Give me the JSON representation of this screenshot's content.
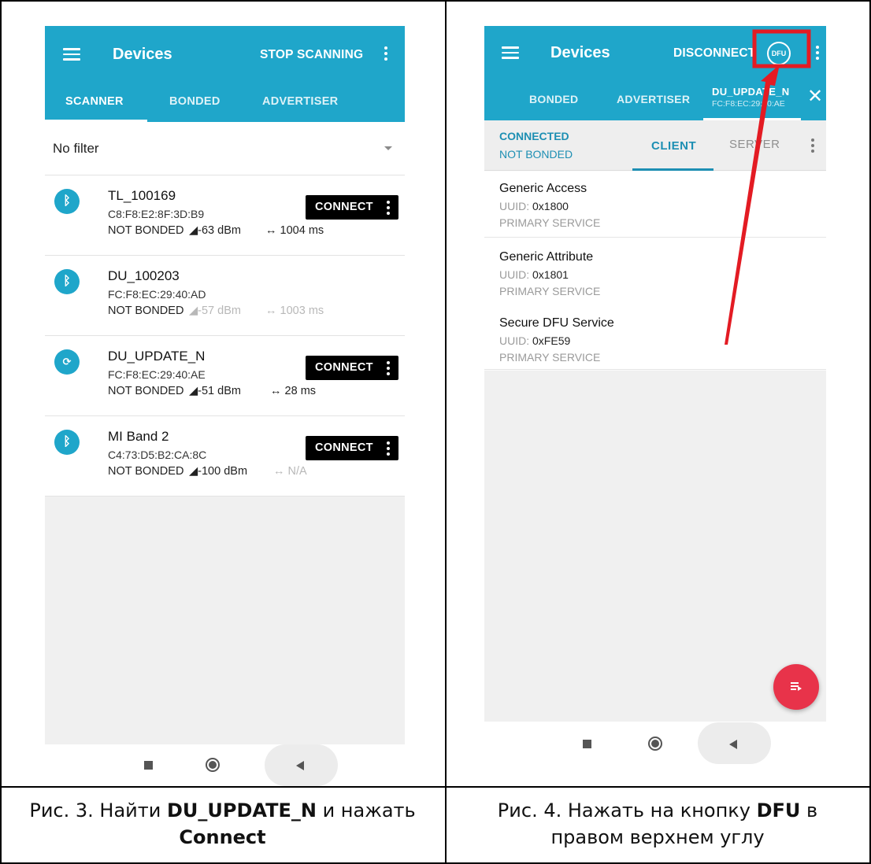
{
  "left_screen": {
    "app_bar": {
      "title": "Devices",
      "action": "STOP SCANNING"
    },
    "tabs": [
      {
        "label": "SCANNER",
        "active": true
      },
      {
        "label": "BONDED",
        "active": false
      },
      {
        "label": "ADVERTISER",
        "active": false
      }
    ],
    "filter": {
      "value": "No filter"
    },
    "devices": [
      {
        "name": "TL_100169",
        "mac": "C8:F8:E2:8F:3D:B9",
        "bond": "NOT BONDED",
        "rssi": "-63 dBm",
        "interval": "1004 ms",
        "connect_label": "CONNECT",
        "connectable": true,
        "icon": "bluetooth-icon"
      },
      {
        "name": "DU_100203",
        "mac": "FC:F8:EC:29:40:AD",
        "bond": "NOT BONDED",
        "rssi": "-57 dBm",
        "interval": "1003 ms",
        "connect_label": "",
        "connectable": false,
        "icon": "bluetooth-icon"
      },
      {
        "name": "DU_UPDATE_N",
        "mac": "FC:F8:EC:29:40:AE",
        "bond": "NOT BONDED",
        "rssi": "-51 dBm",
        "interval": "28 ms",
        "connect_label": "CONNECT",
        "connectable": true,
        "icon": "dfu-device-icon"
      },
      {
        "name": "MI Band 2",
        "mac": "C4:73:D5:B2:CA:8C",
        "bond": "NOT BONDED",
        "rssi": "-100 dBm",
        "interval": "N/A",
        "connect_label": "CONNECT",
        "connectable": true,
        "icon": "bluetooth-icon"
      }
    ]
  },
  "right_screen": {
    "app_bar": {
      "title": "Devices",
      "action": "DISCONNECT",
      "dfu_icon_text": "DFU"
    },
    "tabs": [
      {
        "label": "BONDED"
      },
      {
        "label": "ADVERTISER"
      },
      {
        "label": "DU_UPDATE_N",
        "sublabel": "FC:F8:EC:29:40:AE",
        "active": true
      }
    ],
    "connection": {
      "state": "CONNECTED",
      "bond": "NOT BONDED"
    },
    "sub_tabs": [
      {
        "label": "CLIENT",
        "active": true
      },
      {
        "label": "SERVER",
        "active": false
      }
    ],
    "uuid_label": "UUID:",
    "services": [
      {
        "name": "Generic Access",
        "uuid": "0x1800",
        "type": "PRIMARY SERVICE"
      },
      {
        "name": "Generic Attribute",
        "uuid": "0x1801",
        "type": "PRIMARY SERVICE"
      },
      {
        "name": "Secure DFU Service",
        "uuid": "0xFE59",
        "type": "PRIMARY SERVICE"
      }
    ]
  },
  "captions": {
    "left": {
      "part1": "Рис. 3. Найти ",
      "bold1": "DU_UPDATE_N",
      "part2": " и нажать ",
      "bold2": "Connect"
    },
    "right": {
      "part1": "Рис. 4. Нажать на кнопку ",
      "bold1": "DFU",
      "part2": " в правом верхнем углу"
    }
  },
  "colors": {
    "app_bar": "#1fa6ca",
    "accent": "#1d8fb3",
    "fab": "#e8334a",
    "annotation": "#e31b23"
  }
}
